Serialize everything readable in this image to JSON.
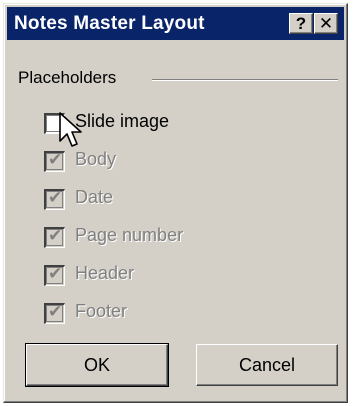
{
  "window": {
    "title": "Notes Master Layout",
    "help_label": "?",
    "close_label": "✕"
  },
  "group": {
    "label": "Placeholders"
  },
  "checkboxes": [
    {
      "label": "Slide image",
      "checked": false,
      "enabled": true
    },
    {
      "label": "Body",
      "checked": true,
      "enabled": false
    },
    {
      "label": "Date",
      "checked": true,
      "enabled": false
    },
    {
      "label": "Page number",
      "checked": true,
      "enabled": false
    },
    {
      "label": "Header",
      "checked": true,
      "enabled": false
    },
    {
      "label": "Footer",
      "checked": true,
      "enabled": false
    }
  ],
  "buttons": {
    "ok_label": "OK",
    "cancel_label": "Cancel"
  },
  "colors": {
    "titlebar": "#0a246a",
    "face": "#d4d0c8",
    "disabled_text": "#808080"
  }
}
